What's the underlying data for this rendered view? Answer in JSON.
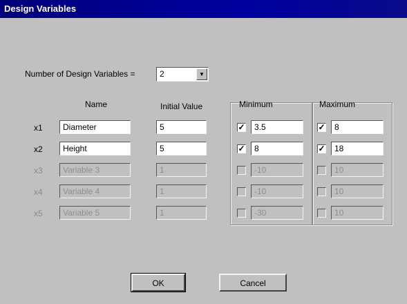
{
  "window": {
    "title": "Design Variables"
  },
  "count": {
    "label": "Number of Design Variables =",
    "value": "2",
    "arrow_icon": "chevron-down-icon"
  },
  "columns": {
    "name": "Name",
    "initial": "Initial Value",
    "minimum": "Minimum",
    "maximum": "Maximum"
  },
  "rows": [
    {
      "id": "x1",
      "name": "Diameter",
      "initial": "5",
      "min_checked": true,
      "min_mark": "✓",
      "min": "3.5",
      "max_checked": true,
      "max_mark": "✓",
      "max": "8",
      "enabled": true
    },
    {
      "id": "x2",
      "name": "Height",
      "initial": "5",
      "min_checked": true,
      "min_mark": "✓",
      "min": "8",
      "max_checked": true,
      "max_mark": "✓",
      "max": "18",
      "enabled": true
    },
    {
      "id": "x3",
      "name": "Variable 3",
      "initial": "1",
      "min_checked": false,
      "min_mark": "",
      "min": "-10",
      "max_checked": false,
      "max_mark": "",
      "max": "10",
      "enabled": false
    },
    {
      "id": "x4",
      "name": "Variable 4",
      "initial": "1",
      "min_checked": false,
      "min_mark": "",
      "min": "-10",
      "max_checked": false,
      "max_mark": "",
      "max": "10",
      "enabled": false
    },
    {
      "id": "x5",
      "name": "Variable 5",
      "initial": "1",
      "min_checked": false,
      "min_mark": "",
      "min": "-30",
      "max_checked": false,
      "max_mark": "",
      "max": "10",
      "enabled": false
    }
  ],
  "buttons": {
    "ok": "OK",
    "cancel": "Cancel"
  }
}
